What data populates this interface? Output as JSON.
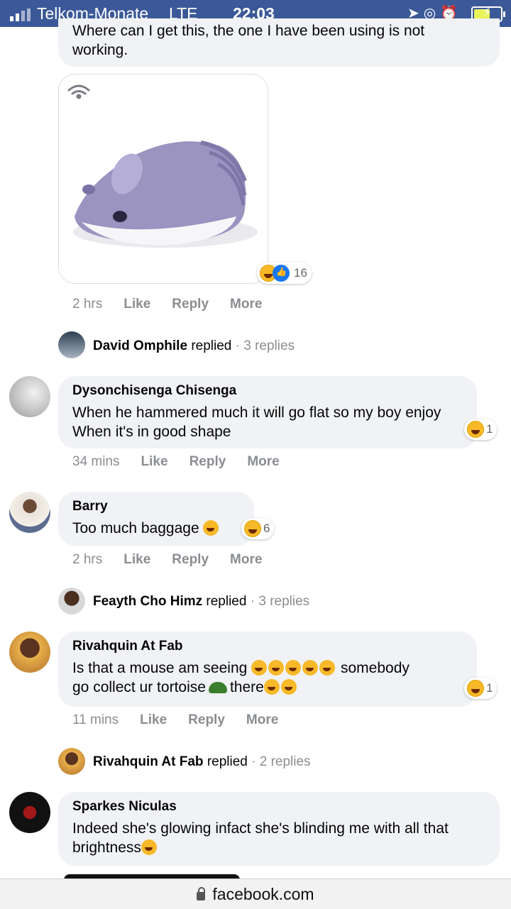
{
  "status_bar": {
    "carrier": "Telkom-Monate",
    "network": "LTE",
    "time": "22:03"
  },
  "top_comment": {
    "text": "Where can I get this, the one I have been using is not working.",
    "reaction_count": "16",
    "time": "2 hrs",
    "like": "Like",
    "reply": "Reply",
    "more": "More"
  },
  "reply_summary_1": {
    "name": "David Omphile",
    "verb": "replied",
    "count": "3 replies"
  },
  "comment_dyson": {
    "name": "Dysonchisenga Chisenga",
    "text": "When he hammered much it will go flat so my boy enjoy When it's in good shape",
    "reaction_count": "1",
    "time": "34 mins",
    "like": "Like",
    "reply": "Reply",
    "more": "More"
  },
  "comment_barry": {
    "name": "Barry",
    "text": "Too much baggage",
    "reaction_count": "6",
    "time": "2 hrs",
    "like": "Like",
    "reply": "Reply",
    "more": "More"
  },
  "reply_summary_2": {
    "name": "Feayth Cho Himz",
    "verb": "replied",
    "count": "3 replies"
  },
  "comment_rivah": {
    "name": "Rivahquin At Fab",
    "text_a": "Is that a mouse am seeing",
    "text_b": "somebody",
    "text_c": "go collect ur tortoise",
    "text_d": "there",
    "reaction_count": "1",
    "time": "11 mins",
    "like": "Like",
    "reply": "Reply",
    "more": "More"
  },
  "reply_summary_3": {
    "name": "Rivahquin At Fab",
    "verb": "replied",
    "count": "2 replies"
  },
  "comment_sparkes": {
    "name": "Sparkes Niculas",
    "text": "Indeed she's glowing infact she's blinding me with all that brightness"
  },
  "address_bar": {
    "domain": "facebook.com"
  },
  "colors": {
    "status_bg": "#3b5998",
    "bubble_bg": "#f0f2f5",
    "meta_text": "#8a8d91"
  }
}
